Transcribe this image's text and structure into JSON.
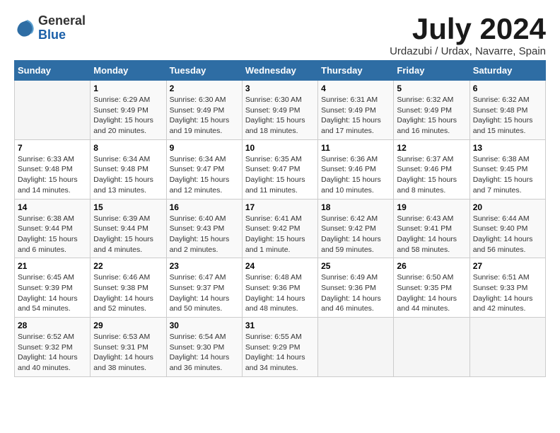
{
  "logo": {
    "general": "General",
    "blue": "Blue"
  },
  "title": "July 2024",
  "location": "Urdazubi / Urdax, Navarre, Spain",
  "days_header": [
    "Sunday",
    "Monday",
    "Tuesday",
    "Wednesday",
    "Thursday",
    "Friday",
    "Saturday"
  ],
  "weeks": [
    [
      {
        "day": "",
        "sunrise": "",
        "sunset": "",
        "daylight": ""
      },
      {
        "day": "1",
        "sunrise": "Sunrise: 6:29 AM",
        "sunset": "Sunset: 9:49 PM",
        "daylight": "Daylight: 15 hours and 20 minutes."
      },
      {
        "day": "2",
        "sunrise": "Sunrise: 6:30 AM",
        "sunset": "Sunset: 9:49 PM",
        "daylight": "Daylight: 15 hours and 19 minutes."
      },
      {
        "day": "3",
        "sunrise": "Sunrise: 6:30 AM",
        "sunset": "Sunset: 9:49 PM",
        "daylight": "Daylight: 15 hours and 18 minutes."
      },
      {
        "day": "4",
        "sunrise": "Sunrise: 6:31 AM",
        "sunset": "Sunset: 9:49 PM",
        "daylight": "Daylight: 15 hours and 17 minutes."
      },
      {
        "day": "5",
        "sunrise": "Sunrise: 6:32 AM",
        "sunset": "Sunset: 9:49 PM",
        "daylight": "Daylight: 15 hours and 16 minutes."
      },
      {
        "day": "6",
        "sunrise": "Sunrise: 6:32 AM",
        "sunset": "Sunset: 9:48 PM",
        "daylight": "Daylight: 15 hours and 15 minutes."
      }
    ],
    [
      {
        "day": "7",
        "sunrise": "Sunrise: 6:33 AM",
        "sunset": "Sunset: 9:48 PM",
        "daylight": "Daylight: 15 hours and 14 minutes."
      },
      {
        "day": "8",
        "sunrise": "Sunrise: 6:34 AM",
        "sunset": "Sunset: 9:48 PM",
        "daylight": "Daylight: 15 hours and 13 minutes."
      },
      {
        "day": "9",
        "sunrise": "Sunrise: 6:34 AM",
        "sunset": "Sunset: 9:47 PM",
        "daylight": "Daylight: 15 hours and 12 minutes."
      },
      {
        "day": "10",
        "sunrise": "Sunrise: 6:35 AM",
        "sunset": "Sunset: 9:47 PM",
        "daylight": "Daylight: 15 hours and 11 minutes."
      },
      {
        "day": "11",
        "sunrise": "Sunrise: 6:36 AM",
        "sunset": "Sunset: 9:46 PM",
        "daylight": "Daylight: 15 hours and 10 minutes."
      },
      {
        "day": "12",
        "sunrise": "Sunrise: 6:37 AM",
        "sunset": "Sunset: 9:46 PM",
        "daylight": "Daylight: 15 hours and 8 minutes."
      },
      {
        "day": "13",
        "sunrise": "Sunrise: 6:38 AM",
        "sunset": "Sunset: 9:45 PM",
        "daylight": "Daylight: 15 hours and 7 minutes."
      }
    ],
    [
      {
        "day": "14",
        "sunrise": "Sunrise: 6:38 AM",
        "sunset": "Sunset: 9:44 PM",
        "daylight": "Daylight: 15 hours and 6 minutes."
      },
      {
        "day": "15",
        "sunrise": "Sunrise: 6:39 AM",
        "sunset": "Sunset: 9:44 PM",
        "daylight": "Daylight: 15 hours and 4 minutes."
      },
      {
        "day": "16",
        "sunrise": "Sunrise: 6:40 AM",
        "sunset": "Sunset: 9:43 PM",
        "daylight": "Daylight: 15 hours and 2 minutes."
      },
      {
        "day": "17",
        "sunrise": "Sunrise: 6:41 AM",
        "sunset": "Sunset: 9:42 PM",
        "daylight": "Daylight: 15 hours and 1 minute."
      },
      {
        "day": "18",
        "sunrise": "Sunrise: 6:42 AM",
        "sunset": "Sunset: 9:42 PM",
        "daylight": "Daylight: 14 hours and 59 minutes."
      },
      {
        "day": "19",
        "sunrise": "Sunrise: 6:43 AM",
        "sunset": "Sunset: 9:41 PM",
        "daylight": "Daylight: 14 hours and 58 minutes."
      },
      {
        "day": "20",
        "sunrise": "Sunrise: 6:44 AM",
        "sunset": "Sunset: 9:40 PM",
        "daylight": "Daylight: 14 hours and 56 minutes."
      }
    ],
    [
      {
        "day": "21",
        "sunrise": "Sunrise: 6:45 AM",
        "sunset": "Sunset: 9:39 PM",
        "daylight": "Daylight: 14 hours and 54 minutes."
      },
      {
        "day": "22",
        "sunrise": "Sunrise: 6:46 AM",
        "sunset": "Sunset: 9:38 PM",
        "daylight": "Daylight: 14 hours and 52 minutes."
      },
      {
        "day": "23",
        "sunrise": "Sunrise: 6:47 AM",
        "sunset": "Sunset: 9:37 PM",
        "daylight": "Daylight: 14 hours and 50 minutes."
      },
      {
        "day": "24",
        "sunrise": "Sunrise: 6:48 AM",
        "sunset": "Sunset: 9:36 PM",
        "daylight": "Daylight: 14 hours and 48 minutes."
      },
      {
        "day": "25",
        "sunrise": "Sunrise: 6:49 AM",
        "sunset": "Sunset: 9:36 PM",
        "daylight": "Daylight: 14 hours and 46 minutes."
      },
      {
        "day": "26",
        "sunrise": "Sunrise: 6:50 AM",
        "sunset": "Sunset: 9:35 PM",
        "daylight": "Daylight: 14 hours and 44 minutes."
      },
      {
        "day": "27",
        "sunrise": "Sunrise: 6:51 AM",
        "sunset": "Sunset: 9:33 PM",
        "daylight": "Daylight: 14 hours and 42 minutes."
      }
    ],
    [
      {
        "day": "28",
        "sunrise": "Sunrise: 6:52 AM",
        "sunset": "Sunset: 9:32 PM",
        "daylight": "Daylight: 14 hours and 40 minutes."
      },
      {
        "day": "29",
        "sunrise": "Sunrise: 6:53 AM",
        "sunset": "Sunset: 9:31 PM",
        "daylight": "Daylight: 14 hours and 38 minutes."
      },
      {
        "day": "30",
        "sunrise": "Sunrise: 6:54 AM",
        "sunset": "Sunset: 9:30 PM",
        "daylight": "Daylight: 14 hours and 36 minutes."
      },
      {
        "day": "31",
        "sunrise": "Sunrise: 6:55 AM",
        "sunset": "Sunset: 9:29 PM",
        "daylight": "Daylight: 14 hours and 34 minutes."
      },
      {
        "day": "",
        "sunrise": "",
        "sunset": "",
        "daylight": ""
      },
      {
        "day": "",
        "sunrise": "",
        "sunset": "",
        "daylight": ""
      },
      {
        "day": "",
        "sunrise": "",
        "sunset": "",
        "daylight": ""
      }
    ]
  ]
}
